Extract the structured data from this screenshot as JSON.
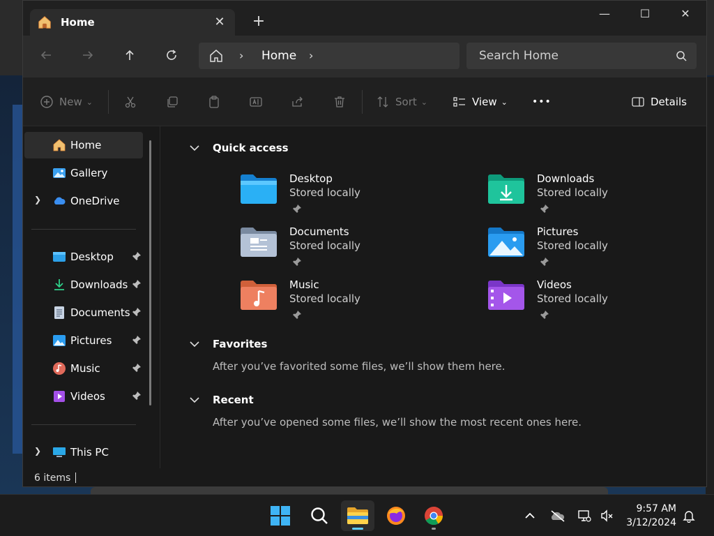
{
  "tab": {
    "title": "Home",
    "close": "✕",
    "add": "+"
  },
  "window_controls": {
    "minimize": "—",
    "maximize": "☐",
    "close": "✕"
  },
  "address": {
    "location": "Home"
  },
  "search": {
    "placeholder": "Search Home"
  },
  "toolbar": {
    "new_label": "New",
    "sort_label": "Sort",
    "view_label": "View",
    "more_label": "•••",
    "details_label": "Details"
  },
  "sidebar": {
    "top": [
      {
        "label": "Home"
      },
      {
        "label": "Gallery"
      },
      {
        "label": "OneDrive"
      }
    ],
    "pinned": [
      {
        "label": "Desktop"
      },
      {
        "label": "Downloads"
      },
      {
        "label": "Documents"
      },
      {
        "label": "Pictures"
      },
      {
        "label": "Music"
      },
      {
        "label": "Videos"
      }
    ],
    "bottom": [
      {
        "label": "This PC"
      }
    ]
  },
  "sections": {
    "quick_access": "Quick access",
    "favorites": "Favorites",
    "favorites_empty": "After you’ve favorited some files, we’ll show them here.",
    "recent": "Recent",
    "recent_empty": "After you’ve opened some files, we’ll show the most recent ones here."
  },
  "quick_access": [
    {
      "name": "Desktop",
      "status": "Stored locally"
    },
    {
      "name": "Downloads",
      "status": "Stored locally"
    },
    {
      "name": "Documents",
      "status": "Stored locally"
    },
    {
      "name": "Pictures",
      "status": "Stored locally"
    },
    {
      "name": "Music",
      "status": "Stored locally"
    },
    {
      "name": "Videos",
      "status": "Stored locally"
    }
  ],
  "status": {
    "item_count": "6 items"
  },
  "clock": {
    "time": "9:57 AM",
    "date": "3/12/2024"
  },
  "colors": {
    "accent": "#60cdff",
    "folder_blue": "#1e9be8",
    "window_bg": "#191919"
  }
}
